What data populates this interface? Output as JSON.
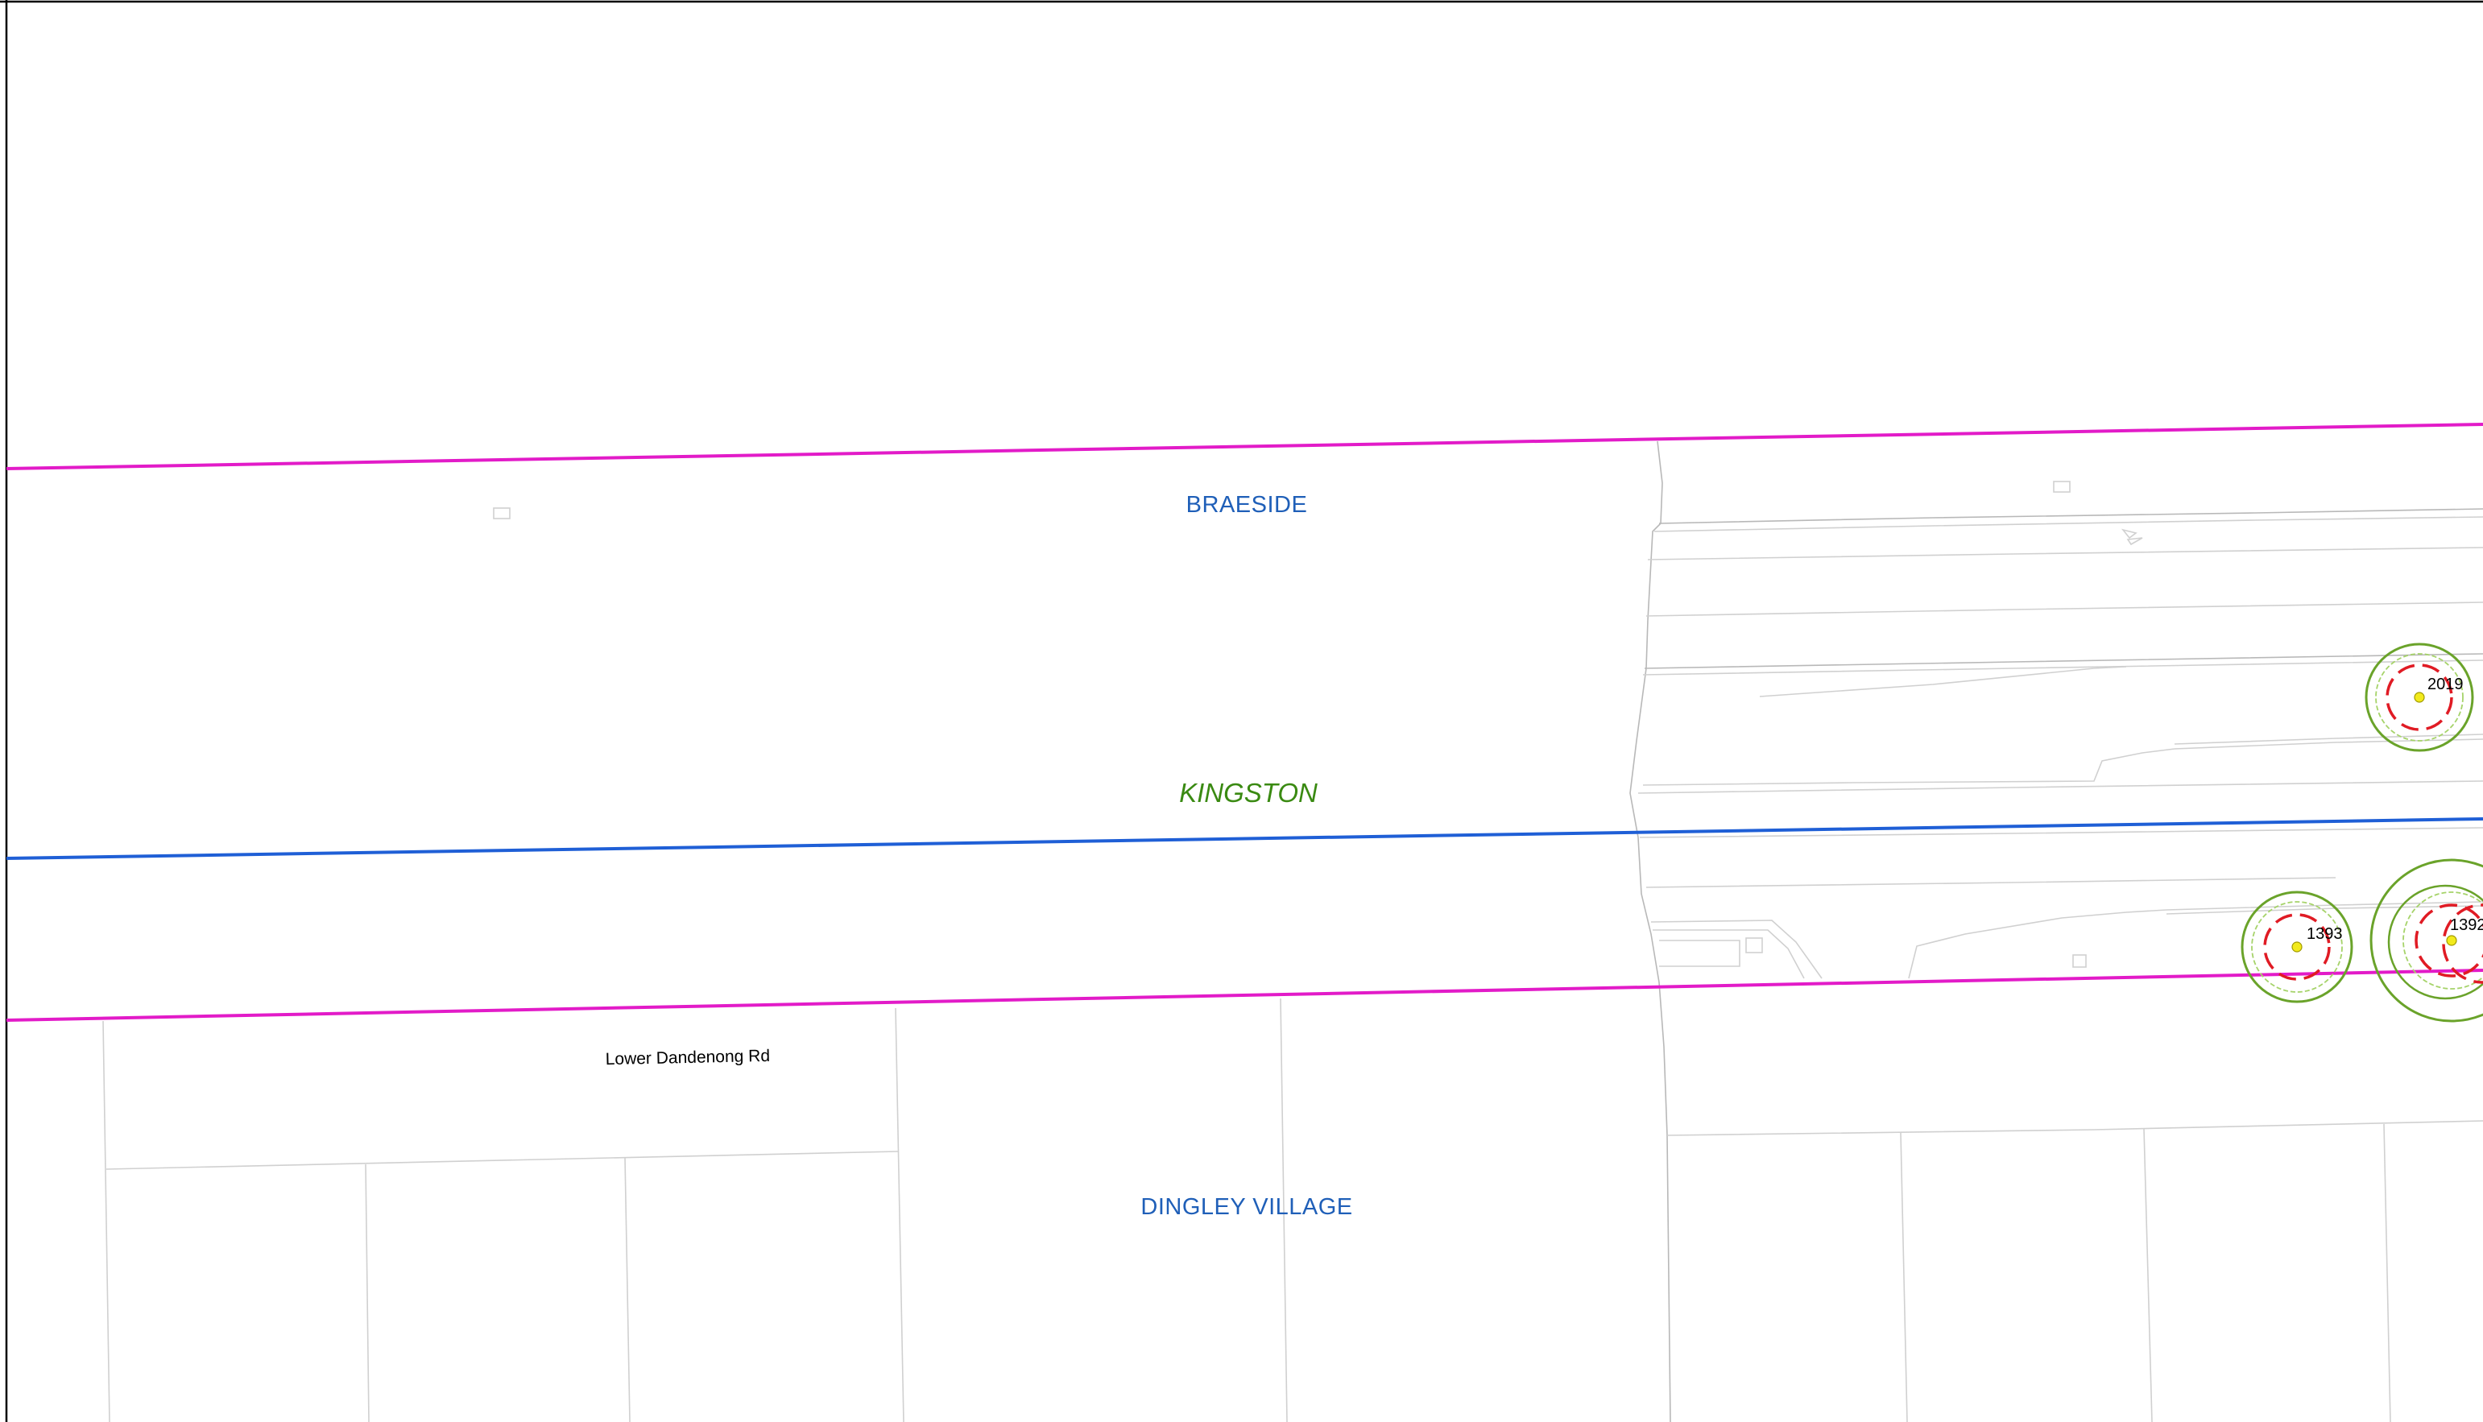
{
  "map": {
    "suburbs": {
      "braeside": "BRAESIDE",
      "dingley_village": "DINGLEY VILLAGE"
    },
    "lga": {
      "kingston": "KINGSTON"
    },
    "roads": {
      "lower_dandenong": "Lower Dandenong Rd"
    },
    "trees": [
      {
        "id": "2019"
      },
      {
        "id": "1393"
      },
      {
        "id": "1392"
      }
    ]
  },
  "colors": {
    "suburb_boundary": "#e21bc8",
    "lga_boundary": "#1f5fd6",
    "suburb_label": "#1f5fb8",
    "lga_label": "#3a8a12",
    "tree_zone_outer": "#6aa32a",
    "tree_zone_inner": "#a6d36a",
    "tree_protection": "#e01b24",
    "tree_point": "#f2ea1c",
    "parcel_line": "#d0d0d0",
    "frame": "#000000"
  }
}
